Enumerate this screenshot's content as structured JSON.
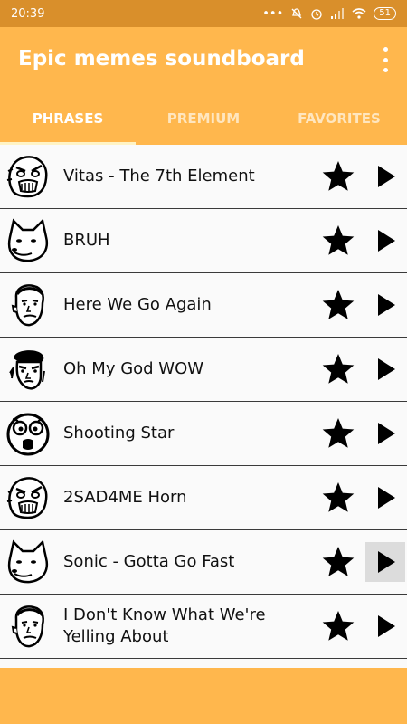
{
  "status": {
    "time": "20:39",
    "battery": "51"
  },
  "app": {
    "title": "Epic memes soundboard"
  },
  "tabs": [
    {
      "label": "PHRASES",
      "active": true
    },
    {
      "label": "PREMIUM",
      "active": false
    },
    {
      "label": "FAVORITES",
      "active": false
    }
  ],
  "sounds": [
    {
      "label": "Vitas - The 7th Element",
      "icon": "rage-face-icon"
    },
    {
      "label": "BRUH",
      "icon": "doge-face-icon"
    },
    {
      "label": "Here We Go Again",
      "icon": "obama-face-icon"
    },
    {
      "label": "Oh My God WOW",
      "icon": "jackie-face-icon"
    },
    {
      "label": "Shooting Star",
      "icon": "surprised-face-icon"
    },
    {
      "label": "2SAD4ME Horn",
      "icon": "rage-face-icon"
    },
    {
      "label": "Sonic - Gotta Go Fast",
      "icon": "doge-face-icon"
    },
    {
      "label": "I Don't Know What We're Yelling About",
      "icon": "obama-face-icon"
    }
  ],
  "colors": {
    "primary": "#ffb74d",
    "status_bar": "#d98f2b",
    "tab_indicator": "#fff3c4"
  }
}
